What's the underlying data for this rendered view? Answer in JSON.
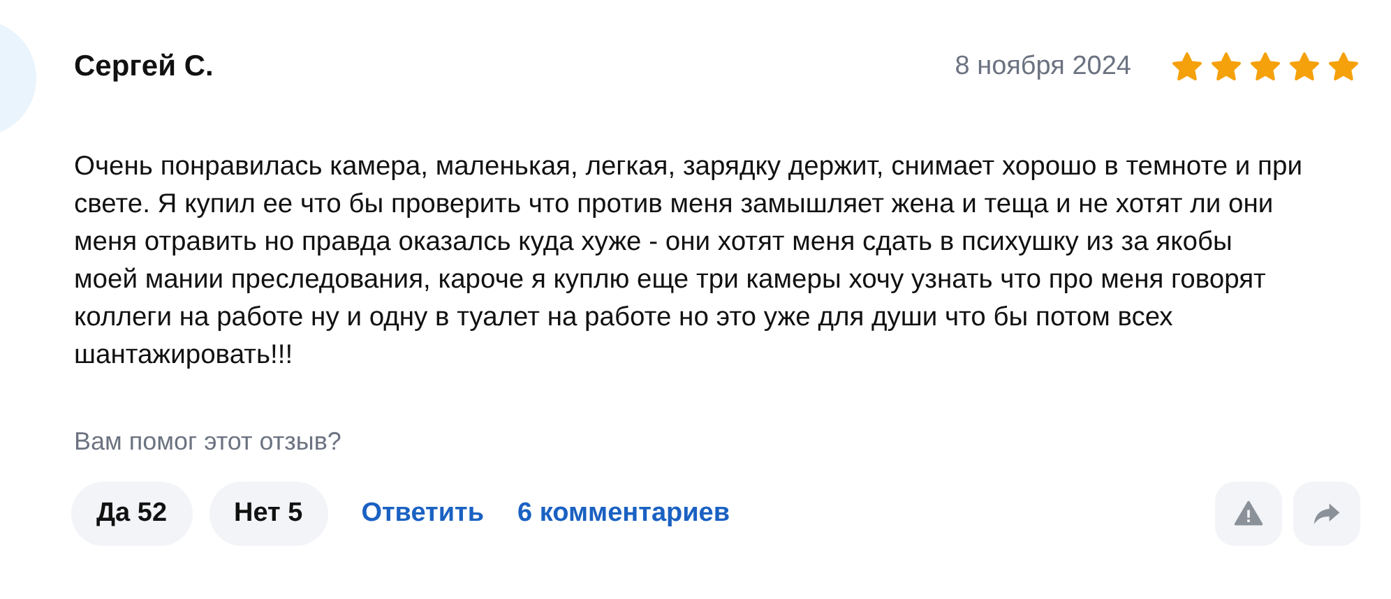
{
  "review": {
    "author": "Сергей С.",
    "date": "8 ноября 2024",
    "stars": 5,
    "text": "Очень понравилась камера, маленькая, легкая, зарядку держит, снимает хорошо в темноте и при свете. Я купил ее что бы проверить что против меня замышляет жена и теща и не хотят ли они меня отравить но правда оказалсь куда хуже - они хотят меня сдать в психушку из за якобы моей мании преследования, кароче я куплю еще три камеры хочу узнать что про меня говорят коллеги на работе ну и одну в туалет на работе но это уже для души что бы потом всех шантажировать!!!",
    "helpful_question": "Вам помог этот отзыв?",
    "votes": [
      {
        "label": "Да 52"
      },
      {
        "label": "Нет 5"
      }
    ],
    "links": [
      {
        "label": "Ответить"
      },
      {
        "label": "6 комментариев"
      }
    ]
  }
}
